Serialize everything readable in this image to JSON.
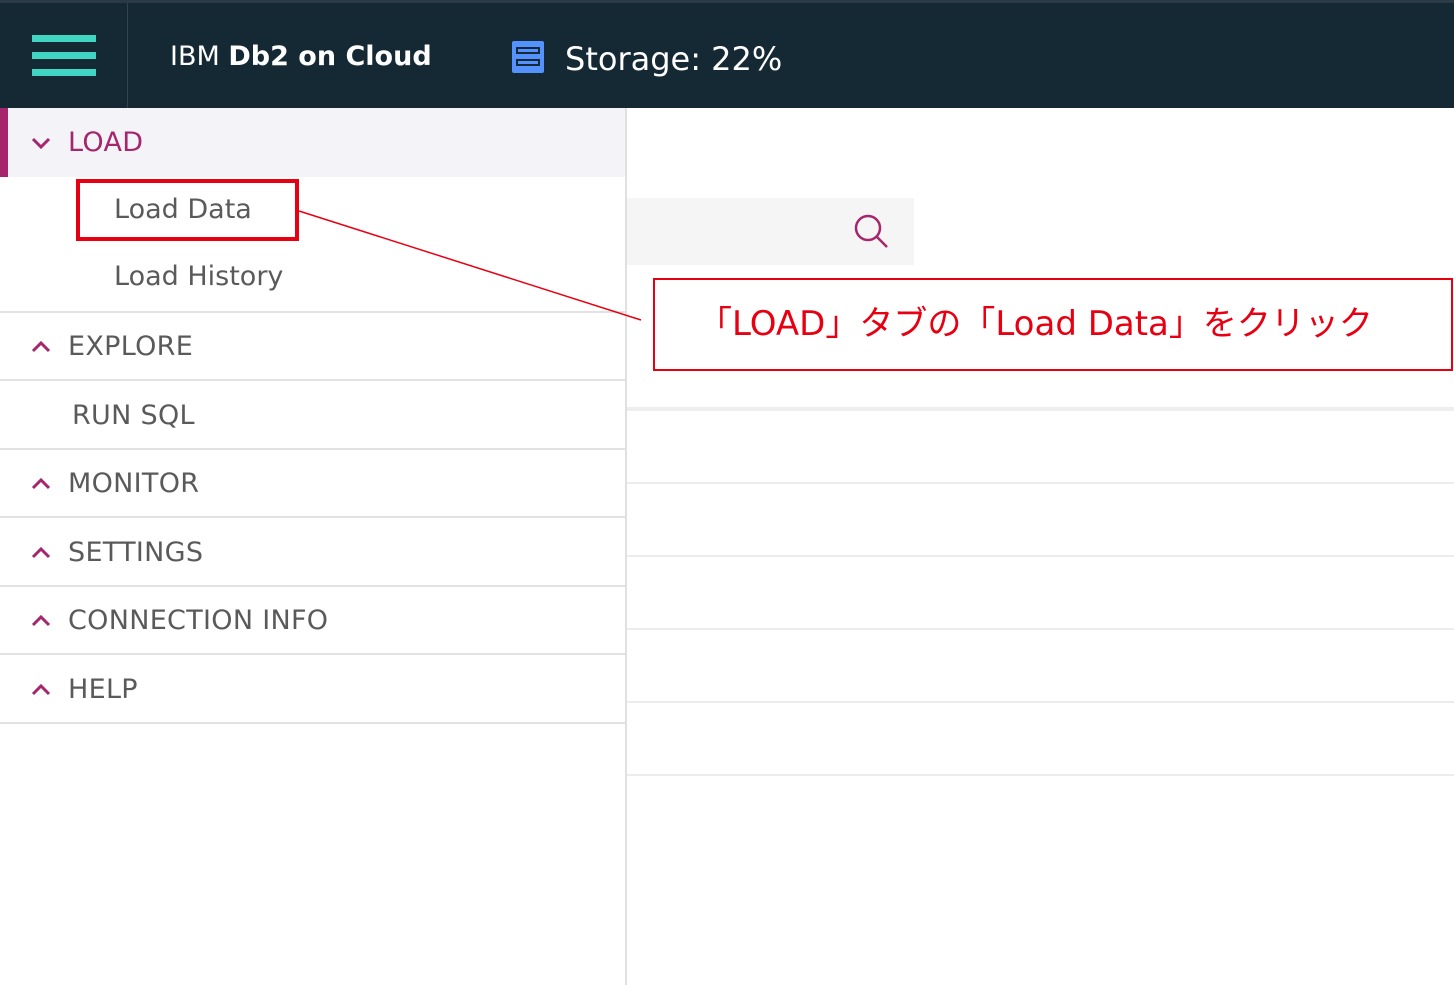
{
  "header": {
    "brand_prefix": "IBM",
    "brand_name": "Db2 on Cloud",
    "storage_label": "Storage: 22%",
    "storage_percent": 22,
    "accent_color": "#41d6c3",
    "background_color": "#152935",
    "storage_icon": "storage-icon"
  },
  "sidebar": {
    "accent_color": "#a6266e",
    "sections": [
      {
        "label": "LOAD",
        "expanded": true,
        "items": [
          "Load Data",
          "Load History"
        ]
      },
      {
        "label": "EXPLORE",
        "expanded": false
      },
      {
        "label": "RUN SQL",
        "expanded": false
      },
      {
        "label": "MONITOR",
        "expanded": false
      },
      {
        "label": "SETTINGS",
        "expanded": false
      },
      {
        "label": "CONNECTION INFO",
        "expanded": false
      },
      {
        "label": "HELP",
        "expanded": false
      }
    ]
  },
  "annotation": {
    "text": "「LOAD」タブの「Load Data」をクリック",
    "color": "#e60012"
  },
  "search": {
    "icon": "search-icon"
  }
}
